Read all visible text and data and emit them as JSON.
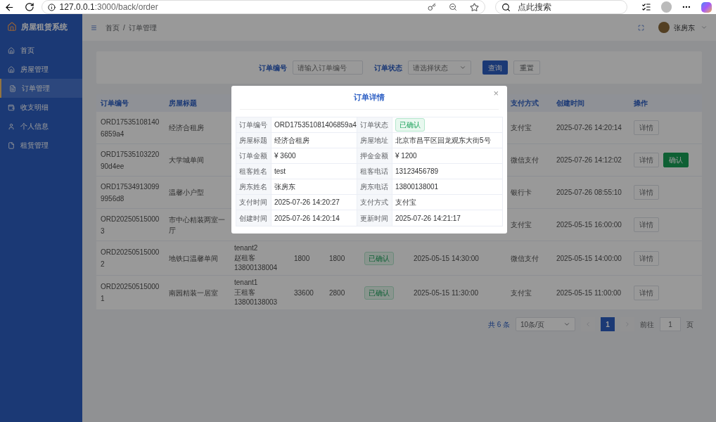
{
  "browser": {
    "url_host": "127.0.0.1",
    "url_rest": ":3000/back/order",
    "search_placeholder": "点此搜索"
  },
  "sidebar": {
    "title": "房屋租赁系统",
    "items": [
      {
        "label": "首页",
        "selected": false
      },
      {
        "label": "房屋管理",
        "selected": false
      },
      {
        "label": "订单管理",
        "selected": true
      },
      {
        "label": "收支明细",
        "selected": false
      },
      {
        "label": "个人信息",
        "selected": false
      },
      {
        "label": "租赁管理",
        "selected": false
      }
    ]
  },
  "header": {
    "breadcrumb": [
      "首页",
      "订单管理"
    ],
    "separator": "/",
    "user": "张房东"
  },
  "filters": [
    {
      "label": "订单编号",
      "kind": "input",
      "placeholder": "请输入订单编号"
    },
    {
      "label": "订单状态",
      "kind": "select",
      "placeholder": "请选择状态"
    }
  ],
  "filter_buttons": [
    {
      "label": "查询",
      "kind": "primary"
    },
    {
      "label": "重置",
      "kind": "default"
    }
  ],
  "table": {
    "columns": [
      "订单编号",
      "房屋标题",
      null,
      null,
      null,
      null,
      null,
      "支付方式",
      "创建时间",
      "操作"
    ],
    "rows": [
      {
        "cells": [
          "ORD17535108140 6859a4",
          "经济合租房",
          null,
          null,
          null,
          null,
          null,
          "支付宝",
          "2025-07-26 14:20:14"
        ],
        "actions": [
          {
            "label": "详情",
            "kind": "default"
          }
        ]
      },
      {
        "cells": [
          "ORD17535103220 90d4ee",
          "大学城单间",
          null,
          null,
          null,
          null,
          null,
          "微信支付",
          "2025-07-26 14:12:02"
        ],
        "actions": [
          {
            "label": "详情",
            "kind": "default"
          },
          {
            "label": "确认",
            "kind": "success"
          }
        ]
      },
      {
        "cells": [
          "ORD17534913099 9956d8",
          "温馨小户型",
          null,
          null,
          null,
          null,
          null,
          "银行卡",
          "2025-07-26 08:55:10"
        ],
        "actions": [
          {
            "label": "详情",
            "kind": "default"
          }
        ]
      },
      {
        "cells": [
          "ORD20250515000 3",
          "市中心精装两室一厅",
          null,
          null,
          null,
          null,
          null,
          "支付宝",
          "2025-05-15 16:00:00"
        ],
        "actions": [
          {
            "label": "详情",
            "kind": "default"
          }
        ]
      },
      {
        "cells": [
          "ORD20250515000 2",
          "地铁口温馨单间",
          [
            "tenant2",
            "赵租客",
            "13800138004"
          ],
          "1800",
          "1800",
          {
            "tag": "已确认"
          },
          "2025-05-15 14:30:00",
          "微信支付",
          "2025-05-15 14:00:00"
        ],
        "actions": [
          {
            "label": "详情",
            "kind": "default"
          }
        ]
      },
      {
        "cells": [
          "ORD20250515000 1",
          "南园精装一居室",
          [
            "tenant1",
            "王租客",
            "13800138003"
          ],
          "33600",
          "2800",
          {
            "tag": "已确认"
          },
          "2025-05-15 11:30:00",
          "支付宝",
          "2025-05-15 11:00:00"
        ],
        "actions": [
          {
            "label": "详情",
            "kind": "default"
          }
        ]
      }
    ]
  },
  "pagination": {
    "total": "共 6 条",
    "page_size": "10条/页",
    "pages": [
      {
        "label": "1",
        "selected": true
      }
    ],
    "goto_label": "前往",
    "goto_value": "1",
    "goto_suffix": "页"
  },
  "dialog": {
    "title": "订单详情",
    "close": "×",
    "rows": [
      [
        {
          "label": "订单编号",
          "value": "ORD175351081406859a4"
        },
        {
          "label": "订单状态",
          "tag": "已确认"
        }
      ],
      [
        {
          "label": "房屋标题",
          "value": "经济合租房"
        },
        {
          "label": "房屋地址",
          "value": "北京市昌平区回龙观东大街5号"
        }
      ],
      [
        {
          "label": "订单金额",
          "value": "¥ 3600"
        },
        {
          "label": "押金金额",
          "value": "¥ 1200"
        }
      ],
      [
        {
          "label": "租客姓名",
          "value": "test"
        },
        {
          "label": "租客电话",
          "value": "13123456789"
        }
      ],
      [
        {
          "label": "房东姓名",
          "value": "张房东"
        },
        {
          "label": "房东电话",
          "value": "13800138001"
        }
      ],
      [
        {
          "label": "支付时间",
          "value": "2025-07-26 14:20:27"
        },
        {
          "label": "支付方式",
          "value": "支付宝"
        }
      ],
      [
        {
          "label": "创建时间",
          "value": "2025-07-26 14:20:14"
        },
        {
          "label": "更新时间",
          "value": "2025-07-26 14:21:17"
        }
      ]
    ]
  }
}
